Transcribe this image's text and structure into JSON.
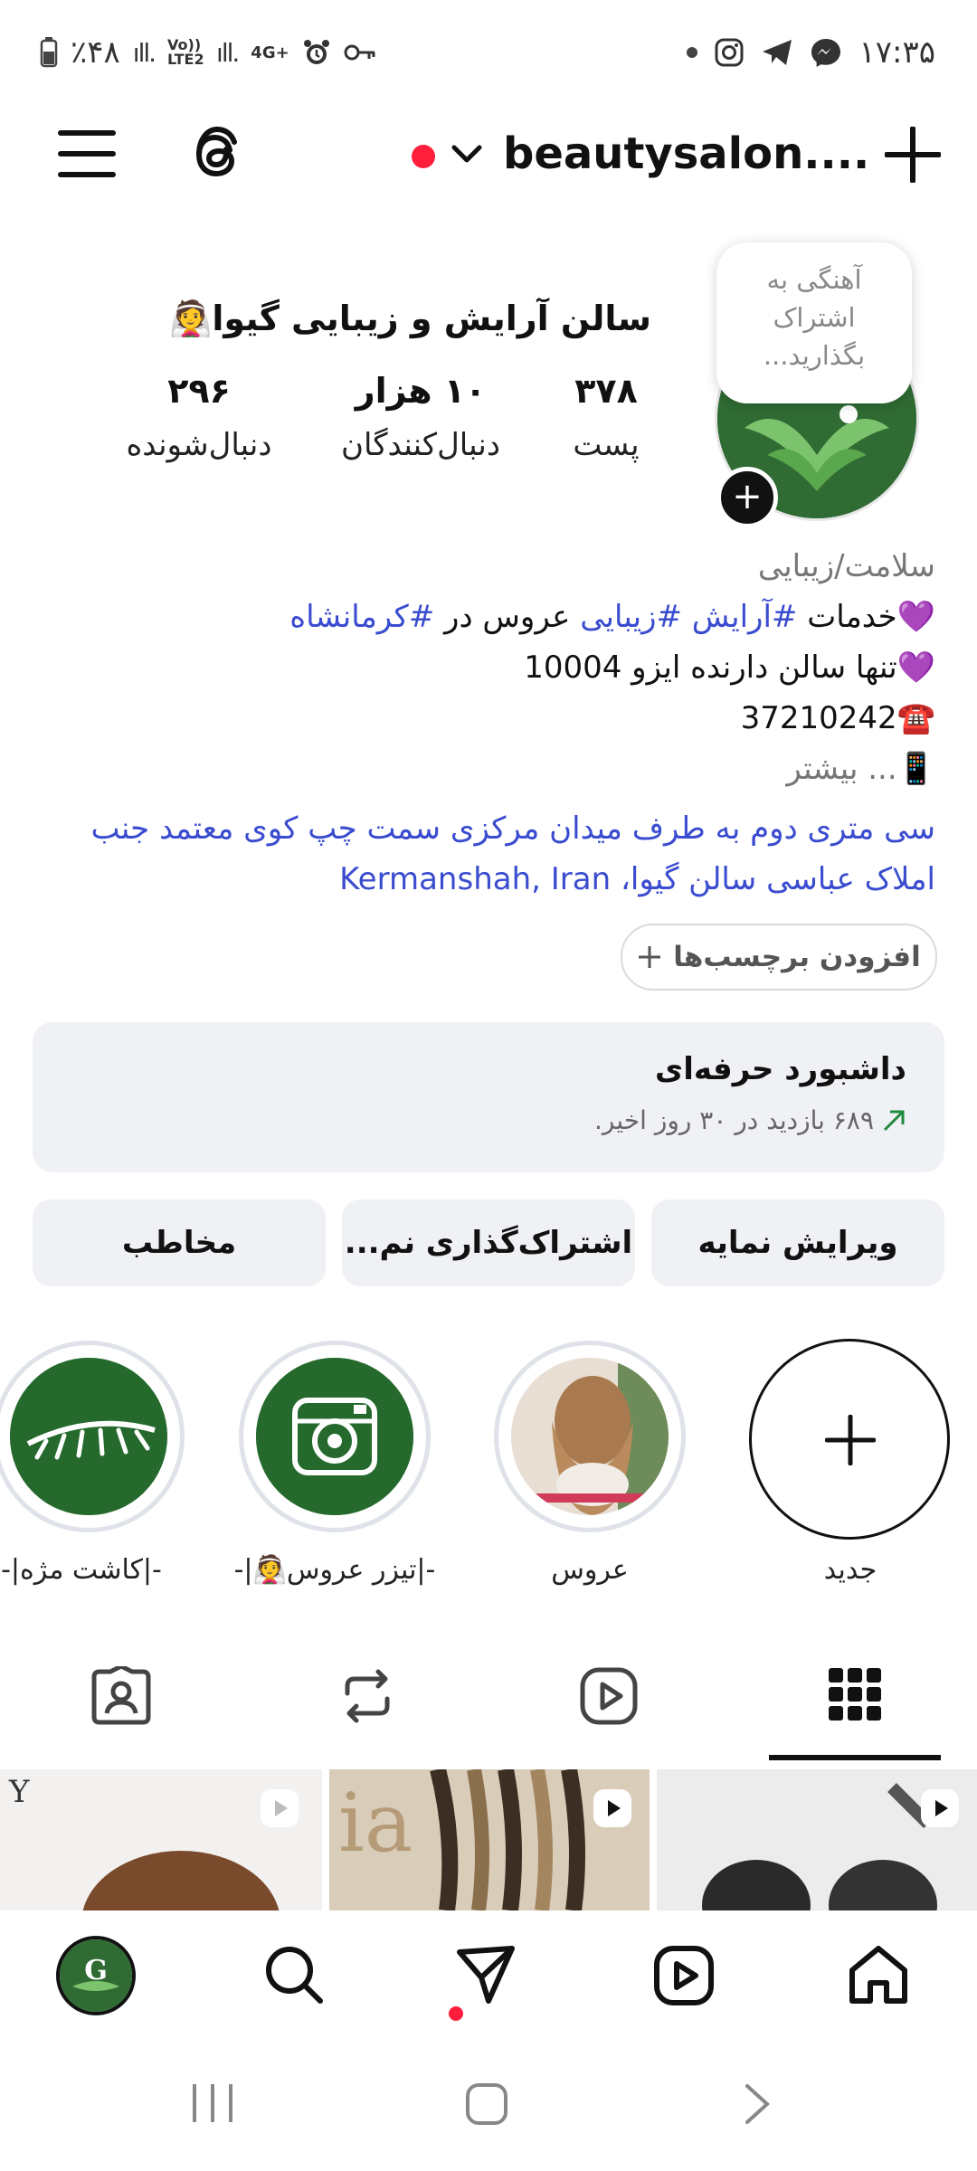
{
  "status_bar": {
    "time": "۱۷:۳۵",
    "battery": "٪۴۸",
    "network_1": "Vo)) LTE2",
    "network_2": "4G+"
  },
  "header": {
    "username": "beautysalon....",
    "icons": [
      "menu-icon",
      "threads-icon",
      "chevron-down-icon",
      "plus-icon"
    ]
  },
  "profile": {
    "name": "سالن آرایش و زیبایی گیوا👰",
    "tooltip_lines": [
      "آهنگی به",
      "اشتراک",
      "بگذارید..."
    ],
    "stats": [
      {
        "value": "۳۷۸",
        "label": "پست"
      },
      {
        "value": "۱۰ هزار",
        "label": "دنبال‌کنندگان"
      },
      {
        "value": "۲۹۶",
        "label": "دنبال‌شونده"
      }
    ],
    "category": "سلامت/زیبایی",
    "bio": {
      "line1_prefix": "💜خدمات ",
      "line1_tag1": "#آرایش",
      "line1_space": " ",
      "line1_tag2": "#زیبایی",
      "line1_mid": " عروس در ",
      "line1_tag3": "#کرمانشاه",
      "line2": "💜تنها سالن دارنده ایزو 10004",
      "line3": "☎️37210242",
      "line4": "📱... بیشتر"
    },
    "address_line1": "سی متری دوم به طرف میدان مرکزی سمت چپ کوی معتمد  جنب",
    "address_line2": "املاک  عباسی سالن گیوا، Kermanshah, Iran",
    "add_tags": "افزودن برچسب‌ها"
  },
  "dashboard": {
    "title": "داشبورد حرفه‌ای",
    "subtitle": "۶۸۹ بازدید در ۳۰ روز اخیر."
  },
  "buttons": {
    "edit_profile": "ویرایش نمایه",
    "share_profile": "اشتراک‌گذاری نم...",
    "contact": "مخاطب"
  },
  "highlights": [
    {
      "label": "جدید"
    },
    {
      "label": "عروس"
    },
    {
      "label": "-|تیزر عروس👰|-"
    },
    {
      "label": "-|کاشت مژه|-"
    }
  ],
  "tabs": [
    "grid-icon",
    "reels-icon",
    "reposts-icon",
    "tagged-icon"
  ],
  "colors": {
    "accent_blue": "#3a4ccf",
    "brand_green": "#2f6b33",
    "notification_red": "#ff1f3d",
    "panel_gray": "#eff1f5"
  }
}
